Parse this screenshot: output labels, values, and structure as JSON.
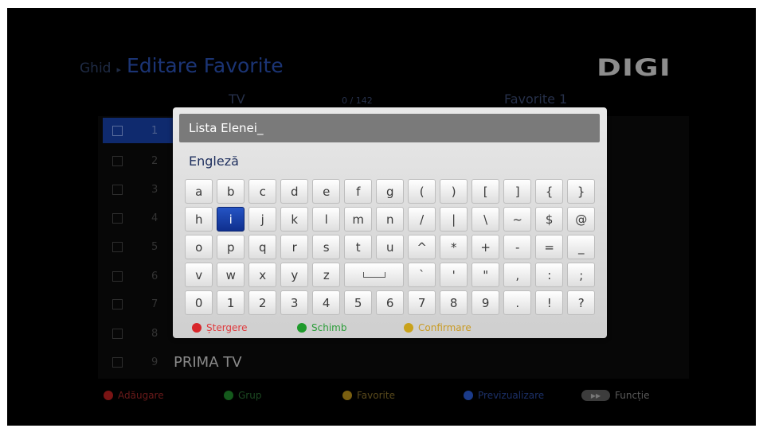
{
  "header": {
    "breadcrumb_parent": "Ghid",
    "separator": "▸",
    "title": "Editare Favorite",
    "logo": "DIGI"
  },
  "columns": {
    "left": "TV",
    "count": "0 / 142",
    "right": "Favorite 1"
  },
  "channel_list": [
    {
      "number": "1",
      "name": ""
    },
    {
      "number": "2",
      "name": ""
    },
    {
      "number": "3",
      "name": ""
    },
    {
      "number": "4",
      "name": ""
    },
    {
      "number": "5",
      "name": ""
    },
    {
      "number": "6",
      "name": ""
    },
    {
      "number": "7",
      "name": ""
    },
    {
      "number": "8",
      "name": ""
    },
    {
      "number": "9",
      "name": "PRIMA TV"
    }
  ],
  "keyboard": {
    "input_value": "Lista Elenei_",
    "language": "Engleză",
    "rows": [
      [
        "a",
        "b",
        "c",
        "d",
        "e",
        "f",
        "g",
        "(",
        ")",
        "[",
        "]",
        "{",
        "}"
      ],
      [
        "h",
        "i",
        "j",
        "k",
        "l",
        "m",
        "n",
        "/",
        "|",
        "\\",
        "~",
        "$",
        "@"
      ],
      [
        "o",
        "p",
        "q",
        "r",
        "s",
        "t",
        "u",
        "^",
        "*",
        "+",
        "-",
        "=",
        "_"
      ],
      [
        "v",
        "w",
        "x",
        "y",
        "z",
        "SPACE",
        "`",
        "'",
        "\"",
        ",",
        ":",
        ";"
      ],
      [
        "0",
        "1",
        "2",
        "3",
        "4",
        "5",
        "6",
        "7",
        "8",
        "9",
        ".",
        "!",
        "?"
      ]
    ],
    "selected_key": "i",
    "legend": [
      {
        "label": "Ștergere",
        "color": "#d8262a",
        "text_color": "#e0393c"
      },
      {
        "label": "Schimb",
        "color": "#1f9a2c",
        "text_color": "#2a9d38"
      },
      {
        "label": "Confirmare",
        "color": "#c9a21b",
        "text_color": "#c99a22"
      }
    ]
  },
  "footer_legend": [
    {
      "label": "Adăugare",
      "color": "#7a1414",
      "text_color": "#6a1a1a"
    },
    {
      "label": "Grup",
      "color": "#145a1c",
      "text_color": "#1c4a22"
    },
    {
      "label": "Favorite",
      "color": "#7a5f10",
      "text_color": "#5a4a1c"
    },
    {
      "label": "Previzualizare",
      "color": "#1b3b8a",
      "text_color": "#1c3068"
    },
    {
      "label": "Funcție",
      "icon": "fast-forward-icon",
      "text_color": "#5a5a5a"
    }
  ]
}
